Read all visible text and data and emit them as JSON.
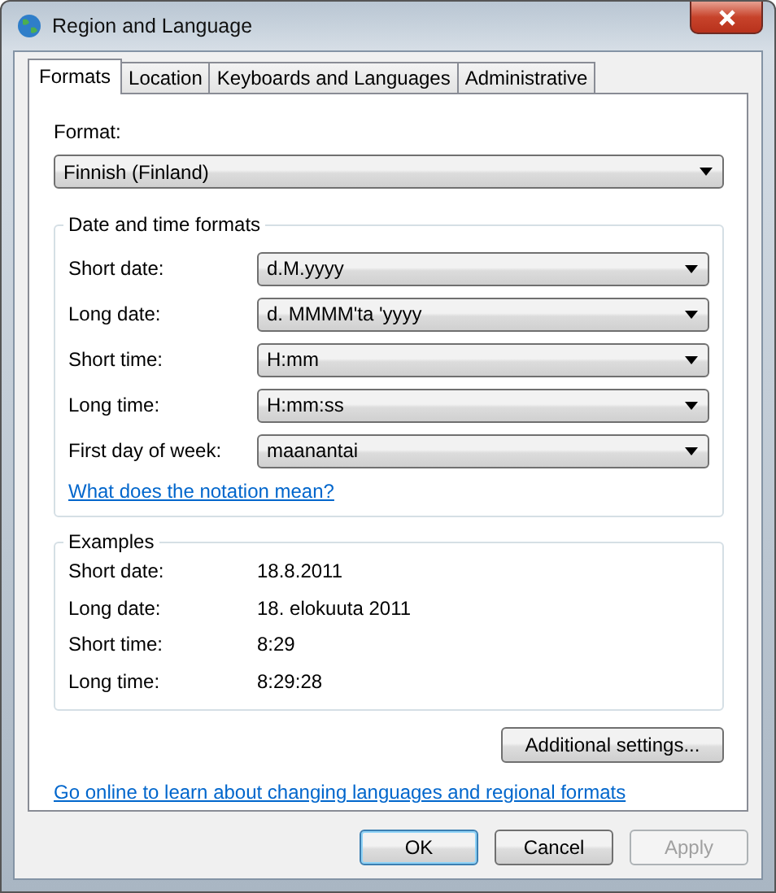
{
  "window": {
    "title": "Region and Language"
  },
  "tabs": [
    {
      "label": "Formats",
      "selected": true
    },
    {
      "label": "Location",
      "selected": false
    },
    {
      "label": "Keyboards and Languages",
      "selected": false
    },
    {
      "label": "Administrative",
      "selected": false
    }
  ],
  "format": {
    "label": "Format:",
    "value": "Finnish (Finland)"
  },
  "date_time_formats": {
    "title": "Date and time formats",
    "fields": [
      {
        "label": "Short date:",
        "value": "d.M.yyyy"
      },
      {
        "label": "Long date:",
        "value": "d. MMMM'ta 'yyyy"
      },
      {
        "label": "Short time:",
        "value": "H:mm"
      },
      {
        "label": "Long time:",
        "value": "H:mm:ss"
      },
      {
        "label": "First day of week:",
        "value": "maanantai"
      }
    ],
    "link": "What does the notation mean?"
  },
  "examples": {
    "title": "Examples",
    "rows": [
      {
        "label": "Short date:",
        "value": "18.8.2011"
      },
      {
        "label": "Long date:",
        "value": "18. elokuuta 2011"
      },
      {
        "label": "Short time:",
        "value": "8:29"
      },
      {
        "label": "Long time:",
        "value": "8:29:28"
      }
    ]
  },
  "additional_button": "Additional settings...",
  "online_link": "Go online to learn about changing languages and regional formats",
  "buttons": [
    {
      "label": "OK",
      "default": true,
      "disabled": false
    },
    {
      "label": "Cancel",
      "default": false,
      "disabled": false
    },
    {
      "label": "Apply",
      "default": false,
      "disabled": true
    }
  ]
}
